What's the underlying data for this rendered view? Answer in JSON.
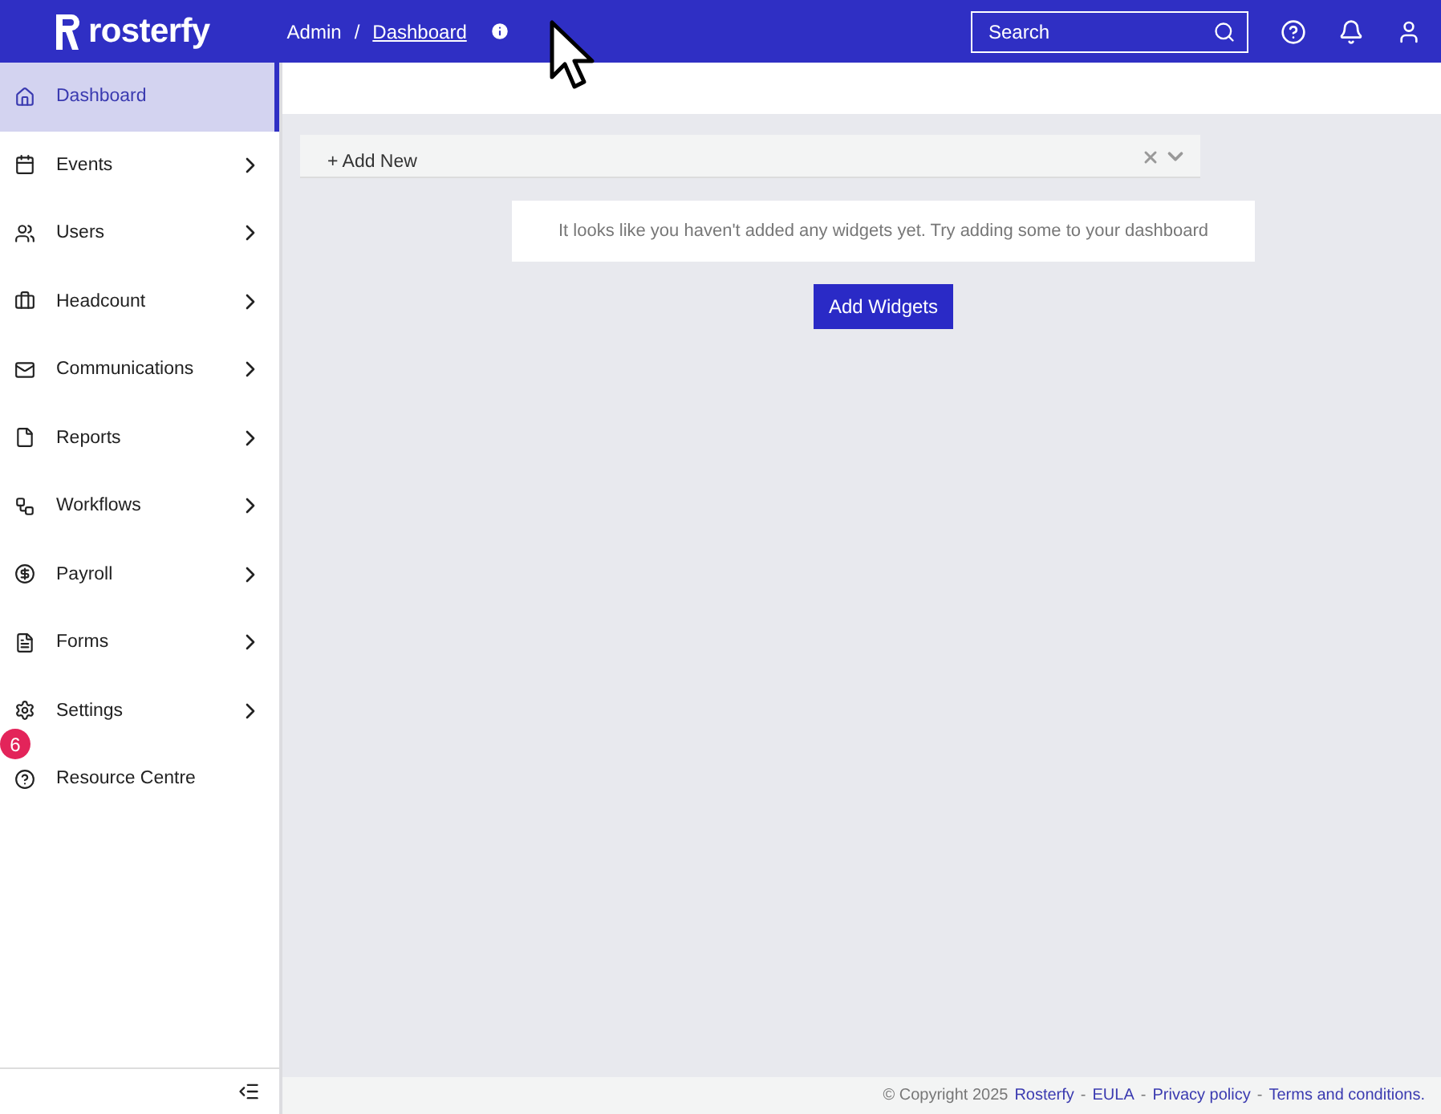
{
  "header": {
    "logo": "rosterfy",
    "breadcrumb": [
      {
        "label": "Admin",
        "link": false
      },
      {
        "label": "Dashboard",
        "link": true
      }
    ],
    "separator": "/",
    "search": {
      "placeholder": "Search"
    }
  },
  "sidebar": {
    "items": [
      {
        "label": "Dashboard",
        "selected": true,
        "expandable": false
      },
      {
        "label": "Events",
        "selected": false,
        "expandable": true
      },
      {
        "label": "Users",
        "selected": false,
        "expandable": true
      },
      {
        "label": "Headcount",
        "selected": false,
        "expandable": true
      },
      {
        "label": "Communications",
        "selected": false,
        "expandable": true
      },
      {
        "label": "Reports",
        "selected": false,
        "expandable": true
      },
      {
        "label": "Workflows",
        "selected": false,
        "expandable": true
      },
      {
        "label": "Payroll",
        "selected": false,
        "expandable": true
      },
      {
        "label": "Forms",
        "selected": false,
        "expandable": true
      },
      {
        "label": "Settings",
        "selected": false,
        "expandable": true
      },
      {
        "label": "Resource Centre",
        "selected": false,
        "expandable": false
      }
    ],
    "badge": "6"
  },
  "dashboard": {
    "add_new": "+ Add New",
    "empty_message": "It looks like you haven't added any widgets yet. Try adding some to your dashboard",
    "button": "Add Widgets"
  },
  "footer": [
    {
      "kind": "text",
      "text": "© Copyright 2025"
    },
    {
      "kind": "link",
      "text": "Rosterfy"
    },
    {
      "kind": "text",
      "text": "-"
    },
    {
      "kind": "link",
      "text": "EULA"
    },
    {
      "kind": "text",
      "text": "-"
    },
    {
      "kind": "link",
      "text": "Privacy policy"
    },
    {
      "kind": "text",
      "text": "-"
    },
    {
      "kind": "link",
      "text": "Terms and conditions."
    }
  ]
}
